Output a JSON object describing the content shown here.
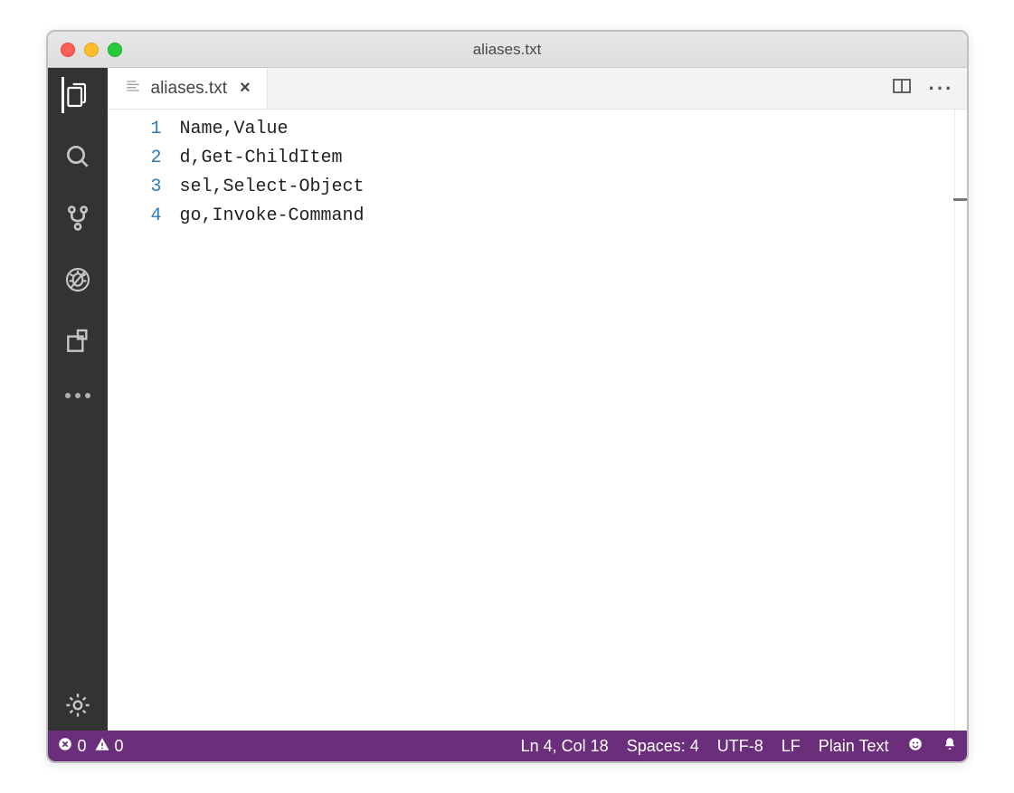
{
  "window": {
    "title": "aliases.txt"
  },
  "tab": {
    "filename": "aliases.txt"
  },
  "editor": {
    "lines": [
      {
        "num": "1",
        "text": "Name,Value"
      },
      {
        "num": "2",
        "text": "d,Get-ChildItem"
      },
      {
        "num": "3",
        "text": "sel,Select-Object"
      },
      {
        "num": "4",
        "text": "go,Invoke-Command"
      }
    ],
    "current_line_index": 3
  },
  "statusbar": {
    "errors": "0",
    "warnings": "0",
    "cursor": "Ln 4, Col 18",
    "indent": "Spaces: 4",
    "encoding": "UTF-8",
    "eol": "LF",
    "language": "Plain Text"
  },
  "activitybar": {
    "overflow": "···"
  },
  "tabactions": {
    "more": "···"
  }
}
